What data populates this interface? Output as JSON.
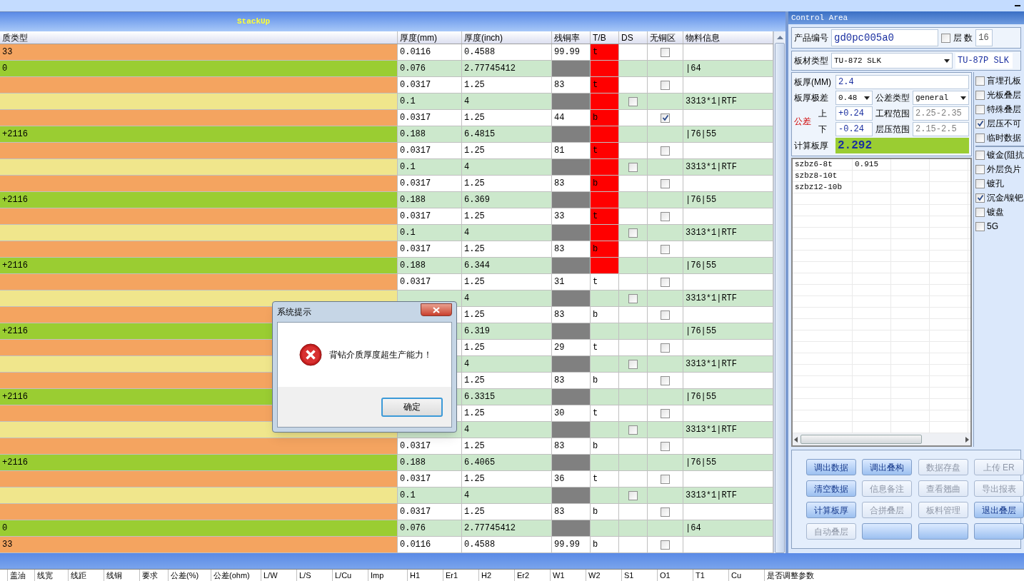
{
  "stackup": {
    "title": "StackUp",
    "columns": [
      "质类型",
      "厚度(mm)",
      "厚度(inch)",
      "残铜率",
      "T/B",
      "DS",
      "无铜区",
      "物料信息"
    ],
    "rows": [
      {
        "kind": "copper",
        "type": "33",
        "mm": "0.0116",
        "inch": "0.4588",
        "residual": "99.99",
        "tb": "t",
        "flagged": true,
        "no_copper": false
      },
      {
        "kind": "core",
        "type": "0",
        "mm": "0.076",
        "inch": "2.77745412",
        "flagged": true,
        "material": "|64"
      },
      {
        "kind": "copper",
        "mm": "0.0317",
        "inch": "1.25",
        "residual": "83",
        "tb": "t",
        "flagged": true,
        "no_copper": false
      },
      {
        "kind": "prepreg",
        "mm": "0.1",
        "inch": "4",
        "flagged": true,
        "ds": false,
        "material": "3313*1|RTF"
      },
      {
        "kind": "copper",
        "mm": "0.0317",
        "inch": "1.25",
        "residual": "44",
        "tb": "b",
        "flagged": true,
        "no_copper": true
      },
      {
        "kind": "core",
        "type": "+2116",
        "mm": "0.188",
        "inch": "6.4815",
        "flagged": true,
        "material": "|76|55"
      },
      {
        "kind": "copper",
        "mm": "0.0317",
        "inch": "1.25",
        "residual": "81",
        "tb": "t",
        "flagged": true,
        "no_copper": false
      },
      {
        "kind": "prepreg",
        "mm": "0.1",
        "inch": "4",
        "flagged": true,
        "ds": false,
        "material": "3313*1|RTF"
      },
      {
        "kind": "copper",
        "mm": "0.0317",
        "inch": "1.25",
        "residual": "83",
        "tb": "b",
        "flagged": true,
        "no_copper": false
      },
      {
        "kind": "core",
        "type": "+2116",
        "mm": "0.188",
        "inch": "6.369",
        "flagged": true,
        "material": "|76|55"
      },
      {
        "kind": "copper",
        "mm": "0.0317",
        "inch": "1.25",
        "residual": "33",
        "tb": "t",
        "flagged": true,
        "no_copper": false
      },
      {
        "kind": "prepreg",
        "mm": "0.1",
        "inch": "4",
        "flagged": true,
        "ds": false,
        "material": "3313*1|RTF"
      },
      {
        "kind": "copper",
        "mm": "0.0317",
        "inch": "1.25",
        "residual": "83",
        "tb": "b",
        "flagged": true,
        "no_copper": false
      },
      {
        "kind": "core",
        "type": "+2116",
        "mm": "0.188",
        "inch": "6.344",
        "flagged": true,
        "material": "|76|55"
      },
      {
        "kind": "copper",
        "mm": "0.0317",
        "inch": "1.25",
        "residual": "31",
        "tb": "t",
        "flagged": false,
        "no_copper": false
      },
      {
        "kind": "prepreg",
        "inch": "4",
        "flagged": false,
        "ds": false,
        "material": "3313*1|RTF"
      },
      {
        "kind": "copper",
        "inch": "1.25",
        "residual": "83",
        "tb": "b",
        "flagged": false,
        "no_copper": false
      },
      {
        "kind": "core",
        "type": "+2116",
        "inch": "6.319",
        "flagged": false,
        "material": "|76|55"
      },
      {
        "kind": "copper",
        "inch": "1.25",
        "residual": "29",
        "tb": "t",
        "flagged": false,
        "no_copper": false
      },
      {
        "kind": "prepreg",
        "inch": "4",
        "flagged": false,
        "ds": false,
        "material": "3313*1|RTF"
      },
      {
        "kind": "copper",
        "inch": "1.25",
        "residual": "83",
        "tb": "b",
        "flagged": false,
        "no_copper": false
      },
      {
        "kind": "core",
        "type": "+2116",
        "inch": "6.3315",
        "flagged": false,
        "material": "|76|55"
      },
      {
        "kind": "copper",
        "inch": "1.25",
        "residual": "30",
        "tb": "t",
        "flagged": false,
        "no_copper": false
      },
      {
        "kind": "prepreg",
        "inch": "4",
        "flagged": false,
        "ds": false,
        "material": "3313*1|RTF"
      },
      {
        "kind": "copper",
        "mm": "0.0317",
        "inch": "1.25",
        "residual": "83",
        "tb": "b",
        "flagged": false,
        "no_copper": false
      },
      {
        "kind": "core",
        "type": "+2116",
        "mm": "0.188",
        "inch": "6.4065",
        "flagged": false,
        "material": "|76|55"
      },
      {
        "kind": "copper",
        "mm": "0.0317",
        "inch": "1.25",
        "residual": "36",
        "tb": "t",
        "flagged": false,
        "no_copper": false
      },
      {
        "kind": "prepreg",
        "mm": "0.1",
        "inch": "4",
        "flagged": false,
        "ds": false,
        "material": "3313*1|RTF"
      },
      {
        "kind": "copper",
        "mm": "0.0317",
        "inch": "1.25",
        "residual": "83",
        "tb": "b",
        "flagged": false,
        "no_copper": false
      },
      {
        "kind": "core",
        "type": "0",
        "mm": "0.076",
        "inch": "2.77745412",
        "flagged": false,
        "material": "|64"
      },
      {
        "kind": "copper",
        "type": "33",
        "mm": "0.0116",
        "inch": "0.4588",
        "residual": "99.99",
        "tb": "b",
        "flagged": false,
        "no_copper": false
      }
    ]
  },
  "control_area": {
    "title": "Control Area",
    "product_no": {
      "label": "产品编号",
      "value": "gd0pc005a0"
    },
    "layer_count": {
      "label": "层 数",
      "checked": false,
      "value": "16"
    },
    "material": {
      "label": "板材类型",
      "value": "TU-872 SLK",
      "alt": "TU-87P SLK"
    },
    "thickness": {
      "label": "板厚(MM)",
      "value": "2.4"
    },
    "range": {
      "label": "板厚极差",
      "value": "0.48"
    },
    "tol_type": {
      "label": "公差类型",
      "value": "general"
    },
    "tolerance": {
      "label": "公差",
      "upper_label": "上",
      "upper": "+0.24",
      "lower_label": "下",
      "lower": "-0.24"
    },
    "eng_range": {
      "label": "工程范围",
      "value": "2.25-2.35",
      "disabled": true
    },
    "press_range": {
      "label": "层压范围",
      "value": "2.15-2.5",
      "disabled": true
    },
    "calc": {
      "label": "计算板厚",
      "value": "2.292"
    },
    "drill_table": [
      [
        "szbz6-8t",
        "0.915"
      ],
      [
        "szbz8-10t"
      ],
      [
        "szbz12-10b"
      ]
    ],
    "options_top": [
      {
        "label": "盲埋孔板",
        "checked": false
      },
      {
        "label": "光板叠层",
        "checked": false
      },
      {
        "label": "特殊叠层",
        "checked": false
      },
      {
        "label": "层压不可",
        "checked": true
      },
      {
        "label": "临时数据",
        "checked": false
      }
    ],
    "options_bottom": [
      {
        "label": "镀金(阻抗",
        "checked": false
      },
      {
        "label": "外层负片",
        "checked": false
      },
      {
        "label": "镀孔",
        "checked": false
      },
      {
        "label": "沉金/镍钯",
        "checked": true
      },
      {
        "label": "镀盘",
        "checked": false
      },
      {
        "label": "5G",
        "checked": false
      }
    ],
    "buttons": [
      {
        "label": "调出数据",
        "disabled": false
      },
      {
        "label": "调出叠构",
        "disabled": false
      },
      {
        "label": "数据存盘",
        "disabled": true
      },
      {
        "label": "上传 ER",
        "disabled": true
      },
      {
        "label": "清空数据",
        "disabled": false
      },
      {
        "label": "信息备注",
        "disabled": true
      },
      {
        "label": "查看翘曲",
        "disabled": true
      },
      {
        "label": "导出报表",
        "disabled": true
      },
      {
        "label": "计算板厚",
        "disabled": false
      },
      {
        "label": "合拼叠层",
        "disabled": true
      },
      {
        "label": "板料管理",
        "disabled": true
      },
      {
        "label": "退出叠层",
        "disabled": false
      },
      {
        "label": "自动叠层",
        "disabled": true
      },
      {
        "disabled": false
      },
      {
        "disabled": false
      },
      {
        "disabled": false
      }
    ]
  },
  "bottom_columns": [
    "盖油",
    "线宽",
    "线距",
    "线铜",
    "要求",
    "公差(%)",
    "公差(ohm)",
    "L/W",
    "L/S",
    "L/Cu",
    "Imp",
    "H1",
    "Er1",
    "H2",
    "Er2",
    "W1",
    "W2",
    "S1",
    "O1",
    "T1",
    "Cu",
    "是否调整参数"
  ],
  "dialog": {
    "title": "系统提示",
    "message": "背钻介质厚度超生产能力！",
    "button": "确定"
  }
}
